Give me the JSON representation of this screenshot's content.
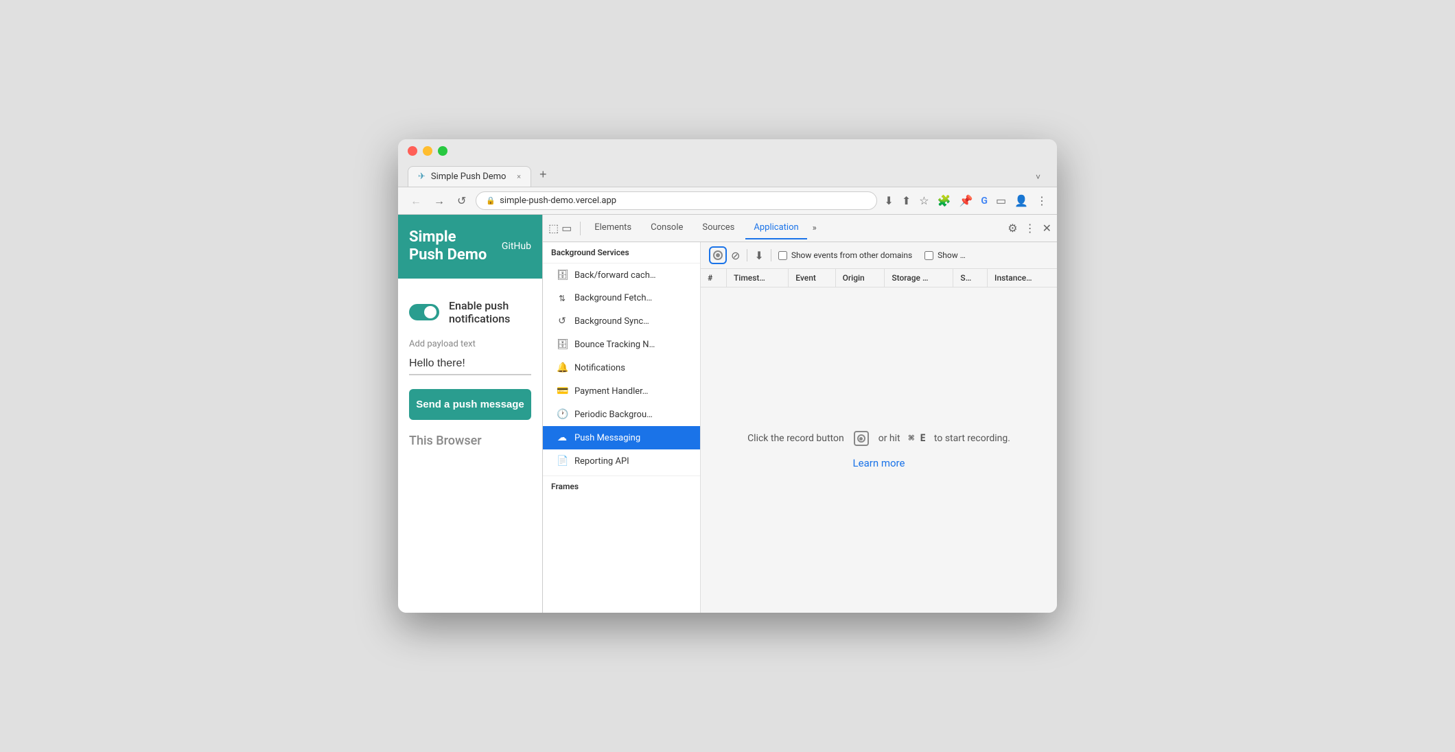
{
  "browser": {
    "tab_title": "Simple Push Demo",
    "tab_close": "×",
    "tab_new": "+",
    "tab_dropdown": "˅",
    "url": "simple-push-demo.vercel.app",
    "nav": {
      "back": "←",
      "forward": "→",
      "refresh": "↺"
    }
  },
  "website": {
    "title_line1": "Simple",
    "title_line2": "Push Demo",
    "github": "GitHub",
    "toggle_label": "Enable push notifications",
    "payload_label": "Add payload text",
    "payload_value": "Hello there!",
    "send_button": "Send a push message",
    "this_browser": "This Browser"
  },
  "devtools": {
    "tabs": [
      {
        "label": "Elements",
        "active": false
      },
      {
        "label": "Console",
        "active": false
      },
      {
        "label": "Sources",
        "active": false
      },
      {
        "label": "Application",
        "active": true
      }
    ],
    "more_tabs": "»",
    "background_services": "Background Services",
    "sidebar_items": [
      {
        "label": "Back/forward cach…",
        "icon": "🗄"
      },
      {
        "label": "Background Fetch…",
        "icon": "↑↓"
      },
      {
        "label": "Background Sync…",
        "icon": "↺"
      },
      {
        "label": "Bounce Tracking N…",
        "icon": "🗄"
      },
      {
        "label": "Notifications",
        "icon": "🔔"
      },
      {
        "label": "Payment Handler…",
        "icon": "💳"
      },
      {
        "label": "Periodic Backgrou…",
        "icon": "🕐"
      },
      {
        "label": "Push Messaging",
        "icon": "☁",
        "active": true
      },
      {
        "label": "Reporting API",
        "icon": "📄"
      }
    ],
    "frames_label": "Frames",
    "table_columns": [
      "#",
      "Timest…",
      "Event",
      "Origin",
      "Storage …",
      "S…",
      "Instance…"
    ],
    "show_events_label": "Show events from other domains",
    "show_label": "Show …",
    "center_message": "Click the record button",
    "shortcut": "⌘ E",
    "shortcut_suffix": "to start recording.",
    "learn_more": "Learn more"
  }
}
